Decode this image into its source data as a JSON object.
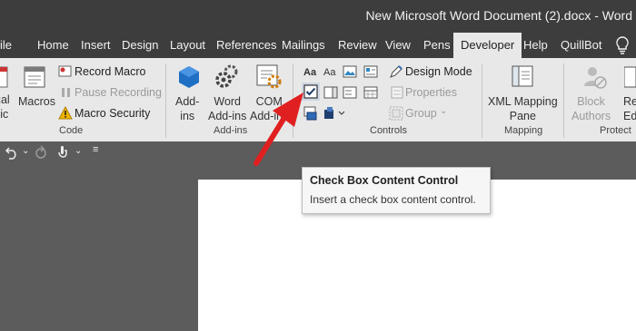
{
  "window": {
    "title": "New Microsoft Word Document (2).docx  -  Word"
  },
  "tabs": [
    "ile",
    "Home",
    "Insert",
    "Design",
    "Layout",
    "References",
    "Mailings",
    "Review",
    "View",
    "Pens",
    "Developer",
    "Help",
    "QuillBot"
  ],
  "active_tab": "Developer",
  "ribbon": {
    "code": {
      "visual_basic": "ual\nsic",
      "macros": "Macros",
      "record_macro": "Record Macro",
      "pause_recording": "Pause Recording",
      "macro_security": "Macro Security",
      "label": "Code"
    },
    "addins": {
      "addins": "Add-\nins",
      "word_addins": "Word\nAdd-ins",
      "com_addins": "COM\nAdd-ins",
      "label": "Add-ins"
    },
    "controls": {
      "design_mode": "Design Mode",
      "properties": "Properties",
      "group": "Group",
      "label": "Controls"
    },
    "mapping": {
      "xml_mapping_pane": "XML Mapping\nPane",
      "label": "Mapping"
    },
    "protect": {
      "block_authors": "Block\nAuthors",
      "restrict_editing": "Re\nEd",
      "label": "Protect"
    }
  },
  "tooltip": {
    "title": "Check Box Content Control",
    "description": "Insert a check box content control."
  },
  "colors": {
    "annotation_arrow": "#e02020",
    "accent": "#2b579a"
  }
}
